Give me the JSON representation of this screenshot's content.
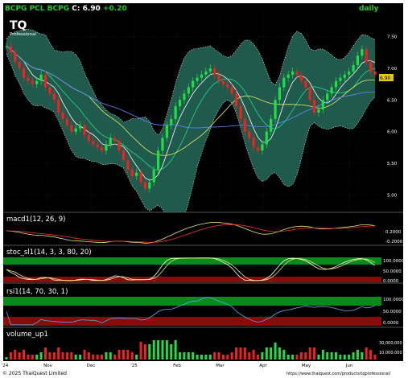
{
  "header": {
    "symbol_line": "BCPG PCL BCPG",
    "close_label": "C:",
    "close_value": "6.90",
    "change": "+0.20",
    "interval": "daily"
  },
  "logo": {
    "text": "TQ",
    "subtext": "Professional"
  },
  "footer": {
    "copyright": "© 2025 ThaiQuest Limited",
    "url": "https://www.thaiquest.com/products/tqprofessional/"
  },
  "colors": {
    "up_candle": "#22dd44",
    "down_candle": "#ee2222",
    "band_fill": "#1f5a4c",
    "band_edge": "#e8e8e8",
    "background": "#000000",
    "header_text": "#22cc22",
    "panel_title": "#ffffff",
    "last_price_tag": "#e8c800",
    "overbought_zone": "#0a8a1a",
    "oversold_zone": "#8a0a0a"
  },
  "chart_data": [
    {
      "type": "candlestick",
      "panel": "price",
      "title": "BCPG PCL BCPG",
      "y_ticks": [
        "7.50",
        "7.00",
        "6.50",
        "6.00",
        "5.50",
        "5.00"
      ],
      "ylim": [
        4.75,
        7.85
      ],
      "x_tick_labels": [
        "'24",
        "Nov",
        "Dec",
        "'25",
        "Feb",
        "Mar",
        "Apr",
        "May",
        "Jun"
      ],
      "last_price_label": "6.90",
      "series": [
        {
          "name": "close",
          "values": [
            7.35,
            7.25,
            7.1,
            7.0,
            6.85,
            6.8,
            6.75,
            6.8,
            6.9,
            6.7,
            6.6,
            6.5,
            6.3,
            6.2,
            6.1,
            6.0,
            6.05,
            6.1,
            5.95,
            5.85,
            5.8,
            5.75,
            5.7,
            5.8,
            5.9,
            5.85,
            5.7,
            5.55,
            5.4,
            5.3,
            5.35,
            5.2,
            5.1,
            5.2,
            5.4,
            5.7,
            5.9,
            6.1,
            6.2,
            6.4,
            6.5,
            6.6,
            6.7,
            6.8,
            6.85,
            6.9,
            6.95,
            7.0,
            6.9,
            6.8,
            6.75,
            6.7,
            6.6,
            6.4,
            6.2,
            6.0,
            5.9,
            5.75,
            5.7,
            5.8,
            6.0,
            6.2,
            6.5,
            6.7,
            6.85,
            6.9,
            6.95,
            6.9,
            6.8,
            6.7,
            6.5,
            6.3,
            6.35,
            6.5,
            6.6,
            6.7,
            6.8,
            6.85,
            6.9,
            6.95,
            7.05,
            7.2,
            7.3,
            7.1,
            6.95,
            6.9
          ]
        }
      ]
    },
    {
      "type": "line",
      "panel": "macd",
      "title": "macd1(12, 26, 9)",
      "y_ticks": [
        "0.2000",
        "0.0000",
        "-0.2000"
      ]
    },
    {
      "type": "line",
      "panel": "stochastic",
      "title": "stoc_sl1(14, 3, 3, 80, 20)",
      "y_ticks": [
        "100.0000",
        "50.0000",
        "0.0000"
      ]
    },
    {
      "type": "line",
      "panel": "rsi",
      "title": "rsi1(14, 70, 30, 1)",
      "y_ticks": [
        "100.0000",
        "50.0000",
        "0.0000"
      ]
    },
    {
      "type": "bar",
      "panel": "volume",
      "title": "volume_up1",
      "y_ticks": [
        "30,000,000",
        "10,000,000"
      ]
    }
  ]
}
